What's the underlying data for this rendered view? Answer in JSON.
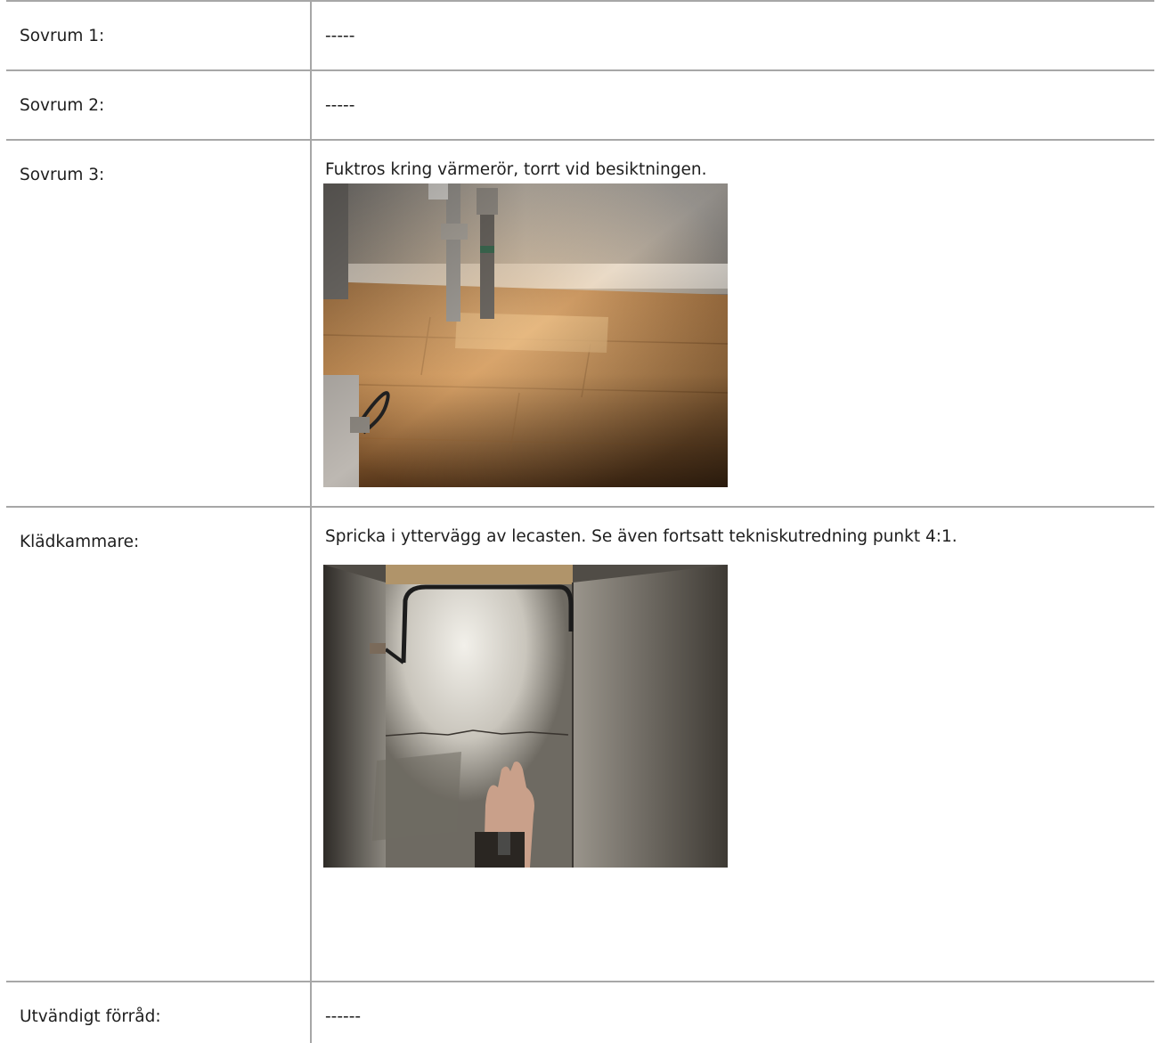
{
  "rows": [
    {
      "label": "Sovrum 1:",
      "value": "-----"
    },
    {
      "label": "Sovrum 2:",
      "value": "-----"
    },
    {
      "label": "Sovrum 3:",
      "value": "Fuktros kring värmerör, torrt vid besiktningen.",
      "photo": "heating-pipes-floor-photo"
    },
    {
      "label": "Klädkammare:",
      "value": "Spricka i yttervägg av lecasten. Se även fortsatt tekniskutredning punkt 4:1.",
      "photo": "closet-wall-crack-photo"
    },
    {
      "label": "Utvändigt förråd:",
      "value": "------"
    }
  ],
  "colors": {
    "border": "#a7a7a7",
    "text": "#1e1e1e"
  }
}
